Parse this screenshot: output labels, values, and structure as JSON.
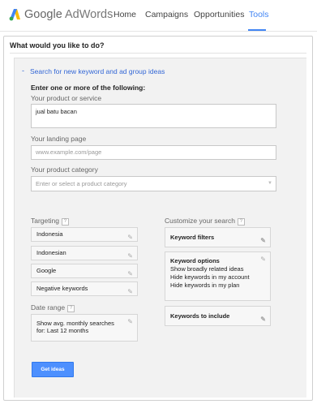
{
  "header": {
    "brand_google": "Google",
    "brand_product": "AdWords",
    "nav": [
      {
        "label": "Home",
        "active": false
      },
      {
        "label": "Campaigns",
        "active": false
      },
      {
        "label": "Opportunities",
        "active": false
      },
      {
        "label": "Tools",
        "active": true
      }
    ],
    "accent_color": "#4285f4"
  },
  "panel": {
    "title": "What would you like to do?",
    "section_link": "Search for new keyword and ad group ideas",
    "intro": "Enter one or more of the following:",
    "product_label": "Your product or service",
    "product_value": "jual batu bacan",
    "landing_label": "Your landing page",
    "landing_placeholder": "www.example.com/page",
    "category_label": "Your product category",
    "category_placeholder": "Enter or select a product category"
  },
  "targeting": {
    "label": "Targeting",
    "help": "?",
    "items": [
      "Indonesia",
      "Indonesian",
      "Google",
      "Negative keywords"
    ]
  },
  "date_range": {
    "label": "Date range",
    "help": "?",
    "line1": "Show avg. monthly searches",
    "line2": "for: Last 12 months"
  },
  "customize": {
    "label": "Customize your search",
    "help": "?",
    "keyword_filters": "Keyword filters",
    "keyword_options": "Keyword options",
    "options": [
      "Show broadly related ideas",
      "Hide keywords in my account",
      "Hide keywords in my plan"
    ],
    "keywords_to_include": "Keywords to include"
  },
  "get_ideas_label": "Get ideas",
  "icons": {
    "edit": "pencil-icon",
    "dropdown": "triangle-down-icon",
    "collapse": "minus-icon"
  }
}
